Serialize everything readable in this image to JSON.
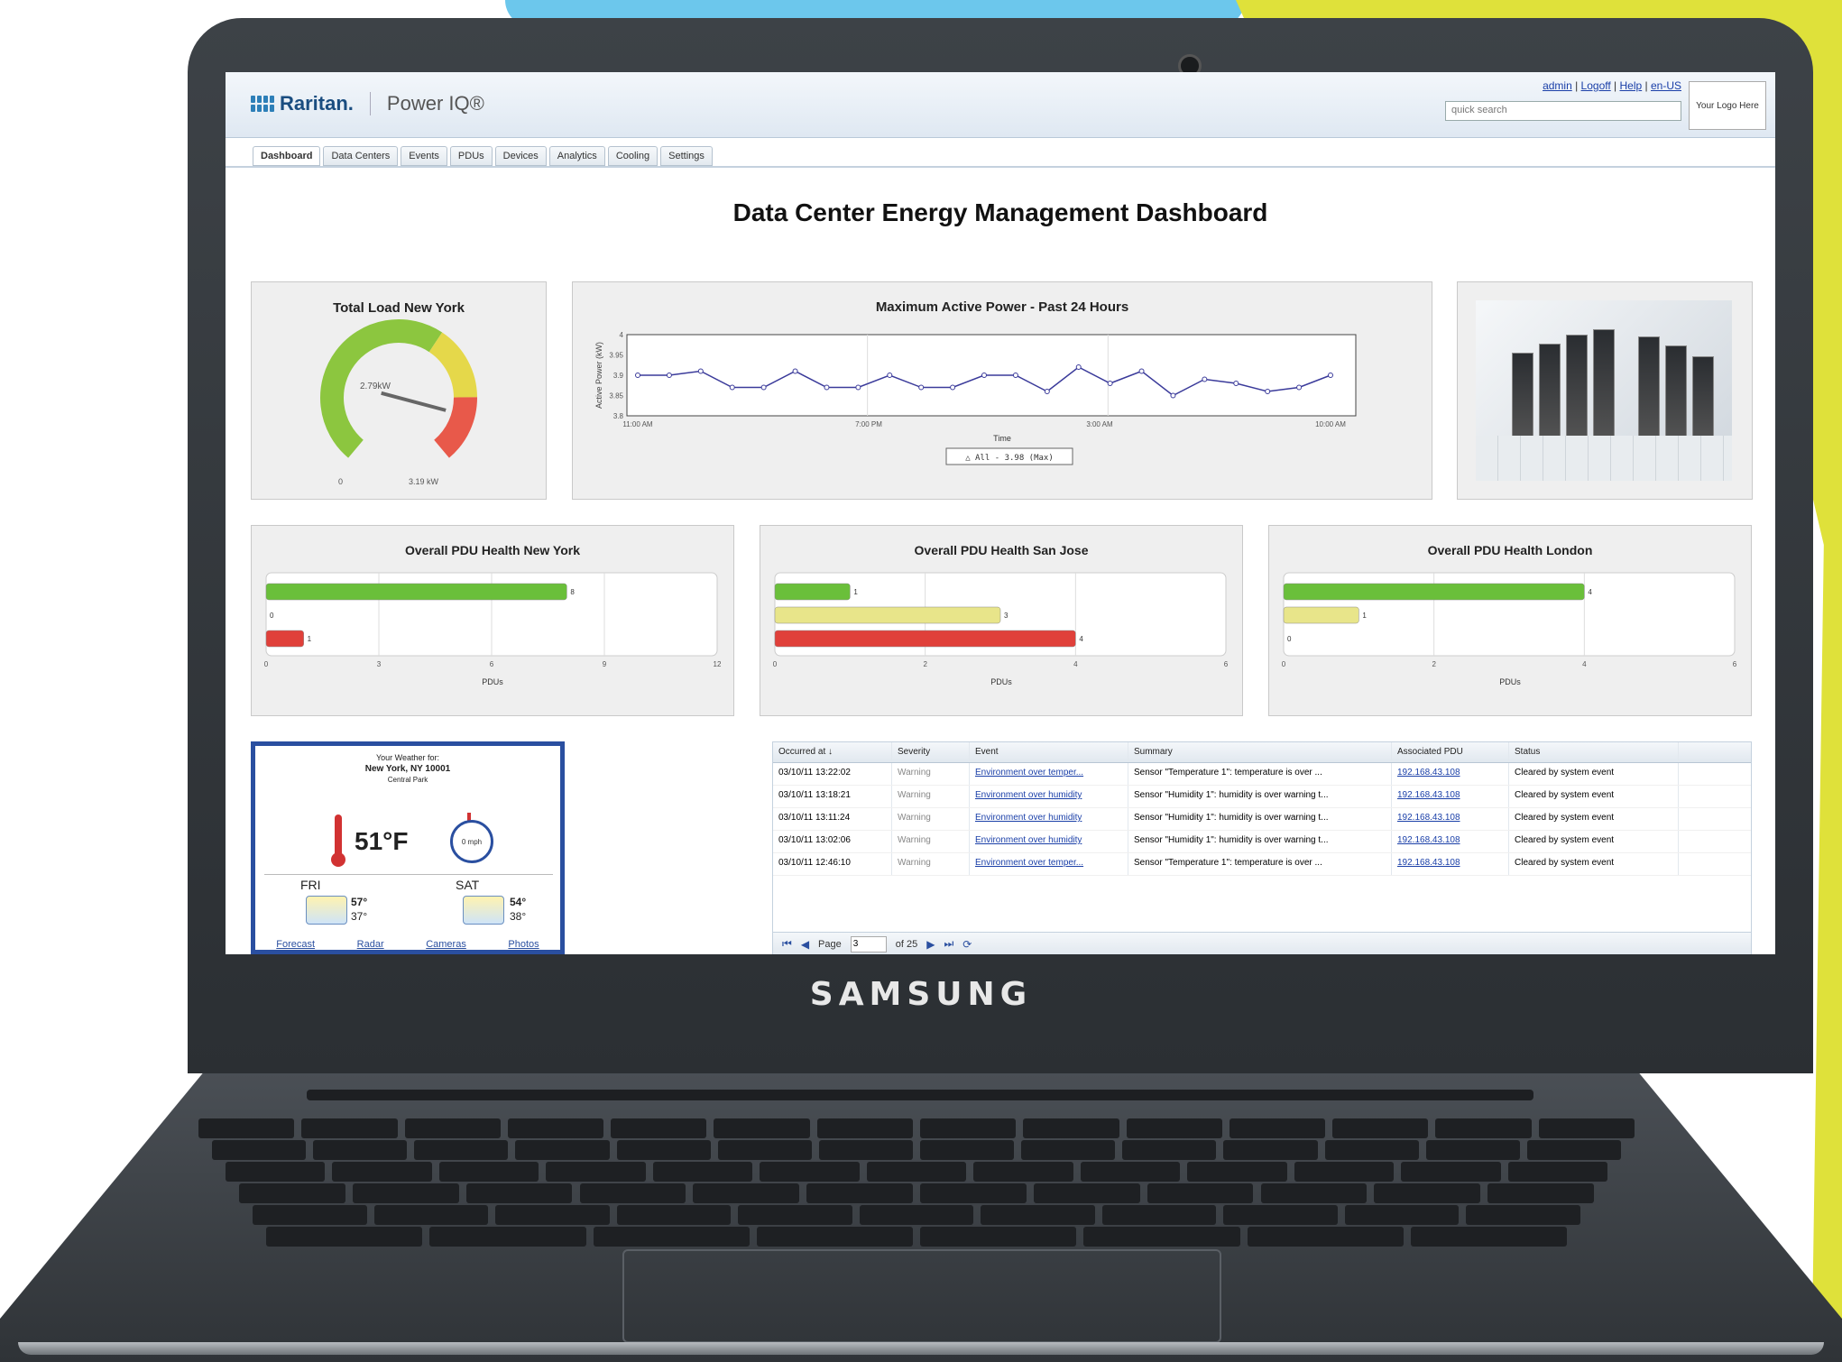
{
  "header": {
    "brand": "Raritan.",
    "product": "Power IQ®",
    "links": [
      "admin",
      "Logoff",
      "Help",
      "en-US"
    ],
    "search_placeholder": "quick search",
    "logo_placeholder": "Your Logo Here"
  },
  "tabs": [
    {
      "label": "Dashboard",
      "active": true
    },
    {
      "label": "Data Centers"
    },
    {
      "label": "Events"
    },
    {
      "label": "PDUs"
    },
    {
      "label": "Devices"
    },
    {
      "label": "Analytics"
    },
    {
      "label": "Cooling"
    },
    {
      "label": "Settings"
    }
  ],
  "page_title": "Data Center Energy Management Dashboard",
  "laptop_brand": "SAMSUNG",
  "gauge": {
    "title": "Total Load New York",
    "value_label": "2.79kW",
    "min_label": "0",
    "max_label": "3.19 kW",
    "value": 2.79,
    "max": 3.19,
    "colors": {
      "green": "#8cc63f",
      "yellow": "#e5d84a",
      "red": "#e8594a"
    }
  },
  "chart_data": [
    {
      "type": "line",
      "title": "Maximum Active Power - Past 24 Hours",
      "xlabel": "Time",
      "ylabel": "Active Power (kW)",
      "x_tick_labels": [
        "11:00 AM",
        "7:00 PM",
        "3:00 AM",
        "10:00 AM"
      ],
      "y_tick_labels": [
        "3.8",
        "3.85",
        "3.9",
        "3.95",
        "4"
      ],
      "ylim": [
        3.8,
        4
      ],
      "legend": "All - 3.98 (Max)",
      "series": [
        {
          "name": "All - 3.98 (Max)",
          "values": [
            3.9,
            3.9,
            3.91,
            3.87,
            3.87,
            3.91,
            3.87,
            3.87,
            3.9,
            3.87,
            3.87,
            3.9,
            3.9,
            3.86,
            3.92,
            3.88,
            3.91,
            3.85,
            3.89,
            3.88,
            3.86,
            3.87,
            3.9
          ]
        }
      ],
      "color": "#3a3a9a"
    },
    {
      "type": "bar",
      "title": "Overall PDU Health New York",
      "xlabel": "PDUs",
      "x_tick_labels": [
        "0",
        "3",
        "6",
        "9",
        "12"
      ],
      "xlim": [
        0,
        12
      ],
      "values": [
        8,
        0,
        1
      ],
      "colors": [
        "#6abf3a",
        "#e8e58a",
        "#e0403a"
      ]
    },
    {
      "type": "bar",
      "title": "Overall PDU Health San Jose",
      "xlabel": "PDUs",
      "x_tick_labels": [
        "0",
        "2",
        "4",
        "6"
      ],
      "xlim": [
        0,
        6
      ],
      "values": [
        1,
        3,
        4
      ],
      "colors": [
        "#6abf3a",
        "#e8e58a",
        "#e0403a"
      ]
    },
    {
      "type": "bar",
      "title": "Overall PDU Health London",
      "xlabel": "PDUs",
      "x_tick_labels": [
        "0",
        "2",
        "4",
        "6"
      ],
      "xlim": [
        0,
        6
      ],
      "values": [
        4,
        1,
        0
      ],
      "colors": [
        "#6abf3a",
        "#e8e58a",
        "#e0403a"
      ]
    }
  ],
  "weather": {
    "heading": "Your Weather for:",
    "location": "New York, NY 10001",
    "station": "Central Park",
    "temp": "51°F",
    "wind_label": "0 mph",
    "days": [
      {
        "name": "FRI",
        "hi": "57°",
        "lo": "37°"
      },
      {
        "name": "SAT",
        "hi": "54°",
        "lo": "38°"
      }
    ],
    "links": [
      "Forecast",
      "Radar",
      "Cameras",
      "Photos"
    ]
  },
  "events": {
    "columns": [
      "Occurred at ↓",
      "Severity",
      "Event",
      "Summary",
      "Associated PDU",
      "Status"
    ],
    "rows": [
      [
        "03/10/11 13:22:02",
        "Warning",
        "Environment over temper...",
        "Sensor \"Temperature 1\": temperature is over ...",
        "192.168.43.108",
        "Cleared by system event"
      ],
      [
        "03/10/11 13:18:21",
        "Warning",
        "Environment over humidity",
        "Sensor \"Humidity 1\": humidity is over warning t...",
        "192.168.43.108",
        "Cleared by system event"
      ],
      [
        "03/10/11 13:11:24",
        "Warning",
        "Environment over humidity",
        "Sensor \"Humidity 1\": humidity is over warning t...",
        "192.168.43.108",
        "Cleared by system event"
      ],
      [
        "03/10/11 13:02:06",
        "Warning",
        "Environment over humidity",
        "Sensor \"Humidity 1\": humidity is over warning t...",
        "192.168.43.108",
        "Cleared by system event"
      ],
      [
        "03/10/11 12:46:10",
        "Warning",
        "Environment over temper...",
        "Sensor \"Temperature 1\": temperature is over ...",
        "192.168.43.108",
        "Cleared by system event"
      ]
    ],
    "pager": {
      "page_label": "Page",
      "page": "3",
      "of_label": "of 25"
    }
  }
}
